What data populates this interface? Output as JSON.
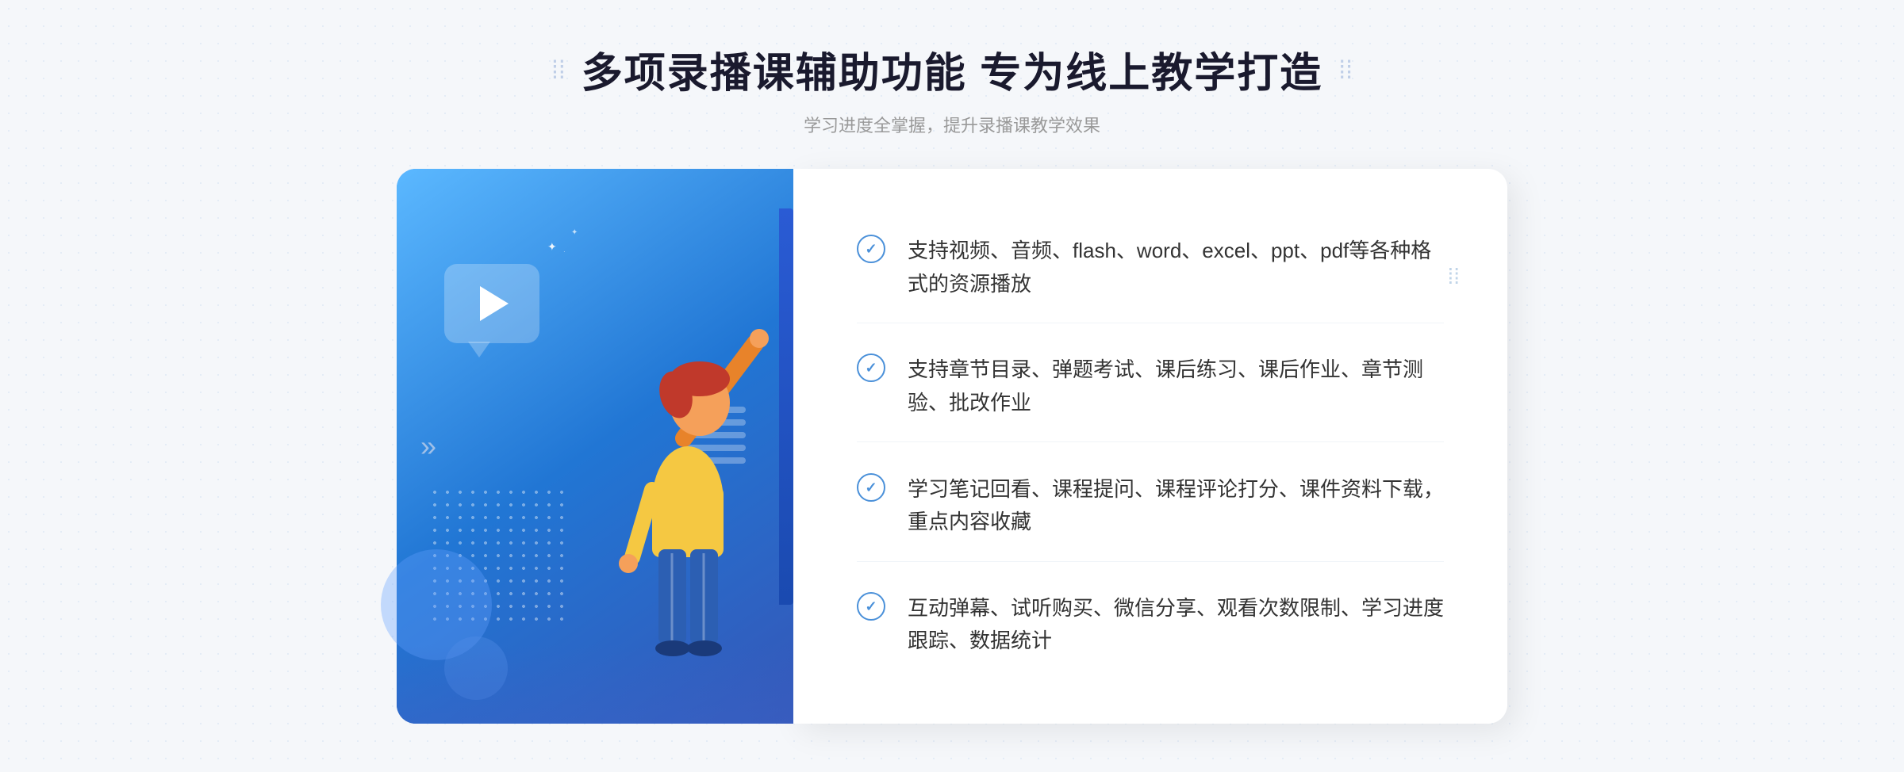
{
  "header": {
    "title": "多项录播课辅助功能 专为线上教学打造",
    "subtitle": "学习进度全掌握，提升录播课教学效果",
    "decorator_left": "⁞⁞",
    "decorator_right": "⁞⁞"
  },
  "features": [
    {
      "id": 1,
      "text": "支持视频、音频、flash、word、excel、ppt、pdf等各种格式的资源播放"
    },
    {
      "id": 2,
      "text": "支持章节目录、弹题考试、课后练习、课后作业、章节测验、批改作业"
    },
    {
      "id": 3,
      "text": "学习笔记回看、课程提问、课程评论打分、课件资料下载，重点内容收藏"
    },
    {
      "id": 4,
      "text": "互动弹幕、试听购买、微信分享、观看次数限制、学习进度跟踪、数据统计"
    }
  ],
  "illustration": {
    "play_button_aria": "play-button",
    "dots_aria": "decorative-dots"
  }
}
